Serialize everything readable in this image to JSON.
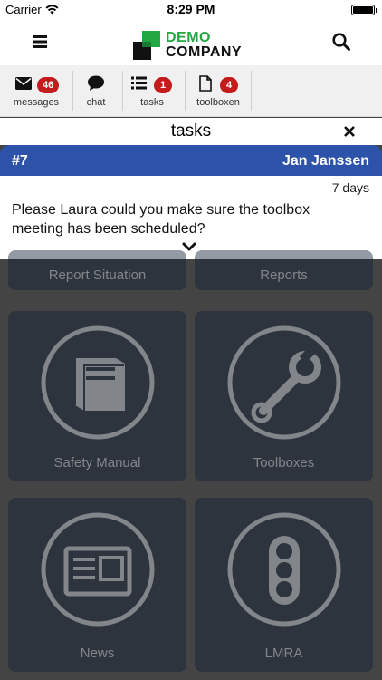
{
  "status_bar": {
    "carrier": "Carrier",
    "time": "8:29 PM"
  },
  "header": {
    "logo_line1": "DEMO",
    "logo_line2": "COMPANY",
    "brand_green": "#21a843"
  },
  "nav": {
    "items": [
      {
        "icon": "envelope-icon",
        "label": "messages",
        "badge": "46"
      },
      {
        "icon": "chat-bubble-icon",
        "label": "chat"
      },
      {
        "icon": "list-icon",
        "label": "tasks",
        "badge": "1"
      },
      {
        "icon": "document-icon",
        "label": "toolboxen",
        "badge": "4"
      }
    ],
    "badge_color": "#c41c1c"
  },
  "tasks_panel": {
    "title": "tasks",
    "task": {
      "id": "#7",
      "assignee": "Jan Janssen",
      "age": "7 days",
      "text": "Please Laura could you make sure the toolbox meeting has been scheduled?"
    },
    "header_color": "#2c53a8"
  },
  "tiles": [
    {
      "label": "Report Situation"
    },
    {
      "label": "Reports"
    },
    {
      "label": "Safety Manual",
      "icon": "book-icon"
    },
    {
      "label": "Toolboxes",
      "icon": "wrench-icon"
    },
    {
      "label": "News",
      "icon": "newspaper-icon"
    },
    {
      "label": "LMRA",
      "icon": "traffic-light-icon"
    }
  ]
}
